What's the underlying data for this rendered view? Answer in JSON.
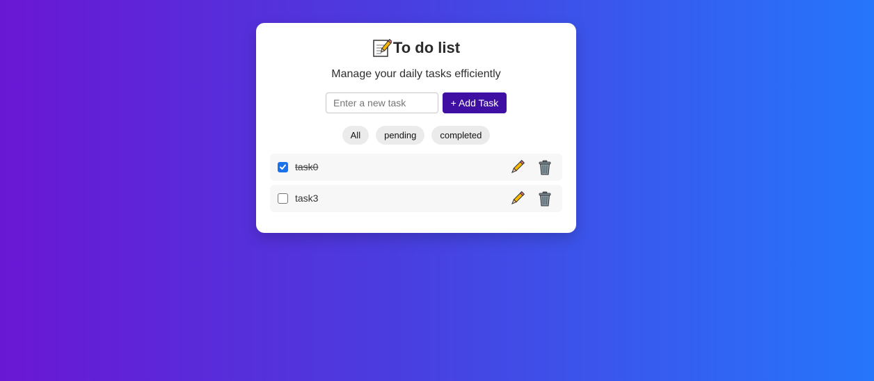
{
  "app": {
    "title": "To do list",
    "title_icon": "memo-icon",
    "subtitle": "Manage your daily tasks efficiently"
  },
  "add_task": {
    "input_value": "",
    "input_placeholder": "Enter a new task",
    "button_label": "+ Add Task"
  },
  "filters": [
    {
      "label": "All"
    },
    {
      "label": "pending"
    },
    {
      "label": "completed"
    }
  ],
  "tasks": [
    {
      "text": "task0",
      "completed": true,
      "edit_icon": "pencil-icon",
      "delete_icon": "trash-icon"
    },
    {
      "text": "task3",
      "completed": false,
      "edit_icon": "pencil-icon",
      "delete_icon": "trash-icon"
    }
  ],
  "colors": {
    "accent": "#3f0fa3",
    "checkbox_checked": "#1a73e8",
    "background_start": "#6a17d3",
    "background_end": "#2576fb"
  }
}
